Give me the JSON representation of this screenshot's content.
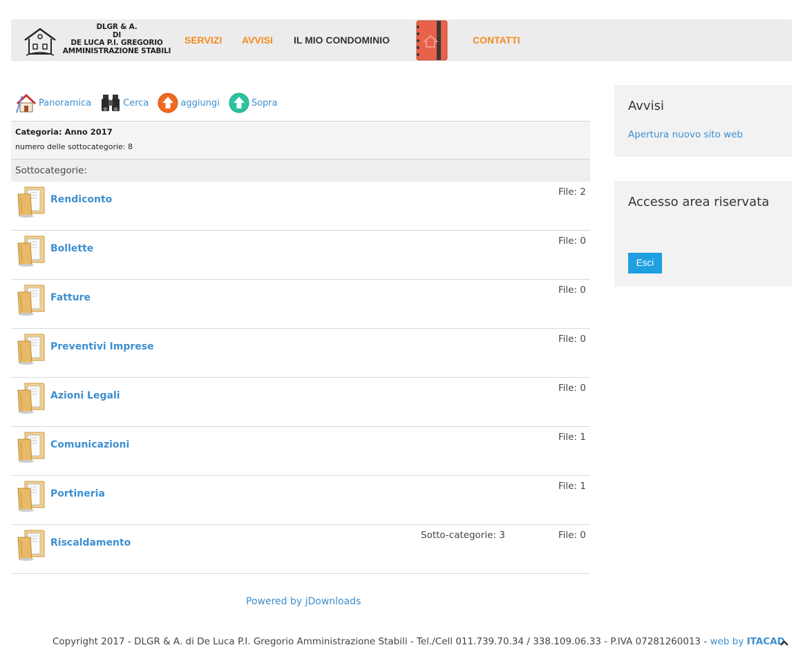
{
  "header": {
    "logo_lines": [
      "DLGR & A.",
      "DI",
      "DE LUCA P.I. GREGORIO",
      "AMMINISTRAZIONE STABILI"
    ],
    "nav": {
      "servizi": "SERVIZI",
      "avvisi": "AVVISI",
      "condominio": "IL MIO CONDOMINIO",
      "contatti": "CONTATTI"
    },
    "accent_color": "#f48a1f"
  },
  "toolbar": {
    "panoramica": "Panoramica",
    "cerca": "Cerca",
    "aggiungi": "aggiungi",
    "sopra": "Sopra"
  },
  "category": {
    "label": "Categoria: Anno 2017",
    "count_label": "numero delle sottocategorie: 8"
  },
  "subcategories": {
    "heading": "Sottocategorie:",
    "items": [
      {
        "name": "Rendiconto",
        "files": "File: 2",
        "subs": ""
      },
      {
        "name": "Bollette",
        "files": "File: 0",
        "subs": ""
      },
      {
        "name": "Fatture",
        "files": "File: 0",
        "subs": ""
      },
      {
        "name": "Preventivi Imprese",
        "files": "File: 0",
        "subs": ""
      },
      {
        "name": "Azioni Legali",
        "files": "File: 0",
        "subs": ""
      },
      {
        "name": "Comunicazioni",
        "files": "File: 1",
        "subs": ""
      },
      {
        "name": "Portineria",
        "files": "File: 1",
        "subs": ""
      },
      {
        "name": "Riscaldamento",
        "files": "File: 0",
        "subs": "Sotto-categorie: 3"
      }
    ]
  },
  "powered": "Powered by jDownloads",
  "sidebar": {
    "avvisi": {
      "title": "Avvisi",
      "link": "Apertura nuovo sito web"
    },
    "accesso": {
      "title": "Accesso area riservata",
      "button": "Esci"
    }
  },
  "footer": {
    "copyright": "Copyright 2017 - DLGR & A. di De Luca P.I. Gregorio Amministrazione Stabili  - Tel./Cell 011.739.70.34 / 338.109.06.33 - P.IVA 07281260013 - ",
    "web_by": "web by",
    "itacad": "ITACAD"
  },
  "link_color": "#3d8ed0",
  "button_color": "#1e9fe0"
}
